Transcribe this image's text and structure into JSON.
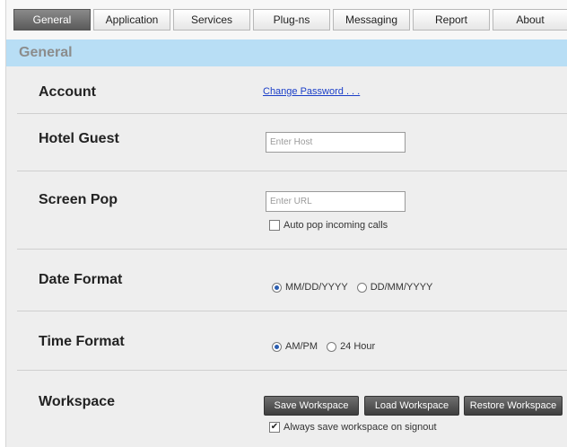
{
  "tabs": [
    {
      "label": "General",
      "active": true
    },
    {
      "label": "Application",
      "active": false
    },
    {
      "label": "Services",
      "active": false
    },
    {
      "label": "Plug-ns",
      "active": false
    },
    {
      "label": "Messaging",
      "active": false
    },
    {
      "label": "Report",
      "active": false
    },
    {
      "label": "About",
      "active": false
    }
  ],
  "section_title": "General",
  "account": {
    "label": "Account",
    "change_password_link": "Change Password . . ."
  },
  "hotel_guest": {
    "label": "Hotel Guest",
    "host_placeholder": "Enter Host",
    "host_value": ""
  },
  "screen_pop": {
    "label": "Screen Pop",
    "url_placeholder": "Enter URL",
    "url_value": "",
    "auto_pop_label": "Auto pop incoming calls",
    "auto_pop_checked": false
  },
  "date_format": {
    "label": "Date Format",
    "options": [
      "MM/DD/YYYY",
      "DD/MM/YYYY"
    ],
    "selected": "MM/DD/YYYY"
  },
  "time_format": {
    "label": "Time Format",
    "options": [
      "AM/PM",
      "24 Hour"
    ],
    "selected": "AM/PM"
  },
  "workspace": {
    "label": "Workspace",
    "save_button": "Save Workspace",
    "load_button": "Load Workspace",
    "restore_button": "Restore Workspace",
    "always_save_label": "Always save workspace on signout",
    "always_save_checked": true
  },
  "colors": {
    "section_header_bg": "#b8def5",
    "link": "#1a3ec8",
    "active_tab": "#6a6a6a"
  }
}
